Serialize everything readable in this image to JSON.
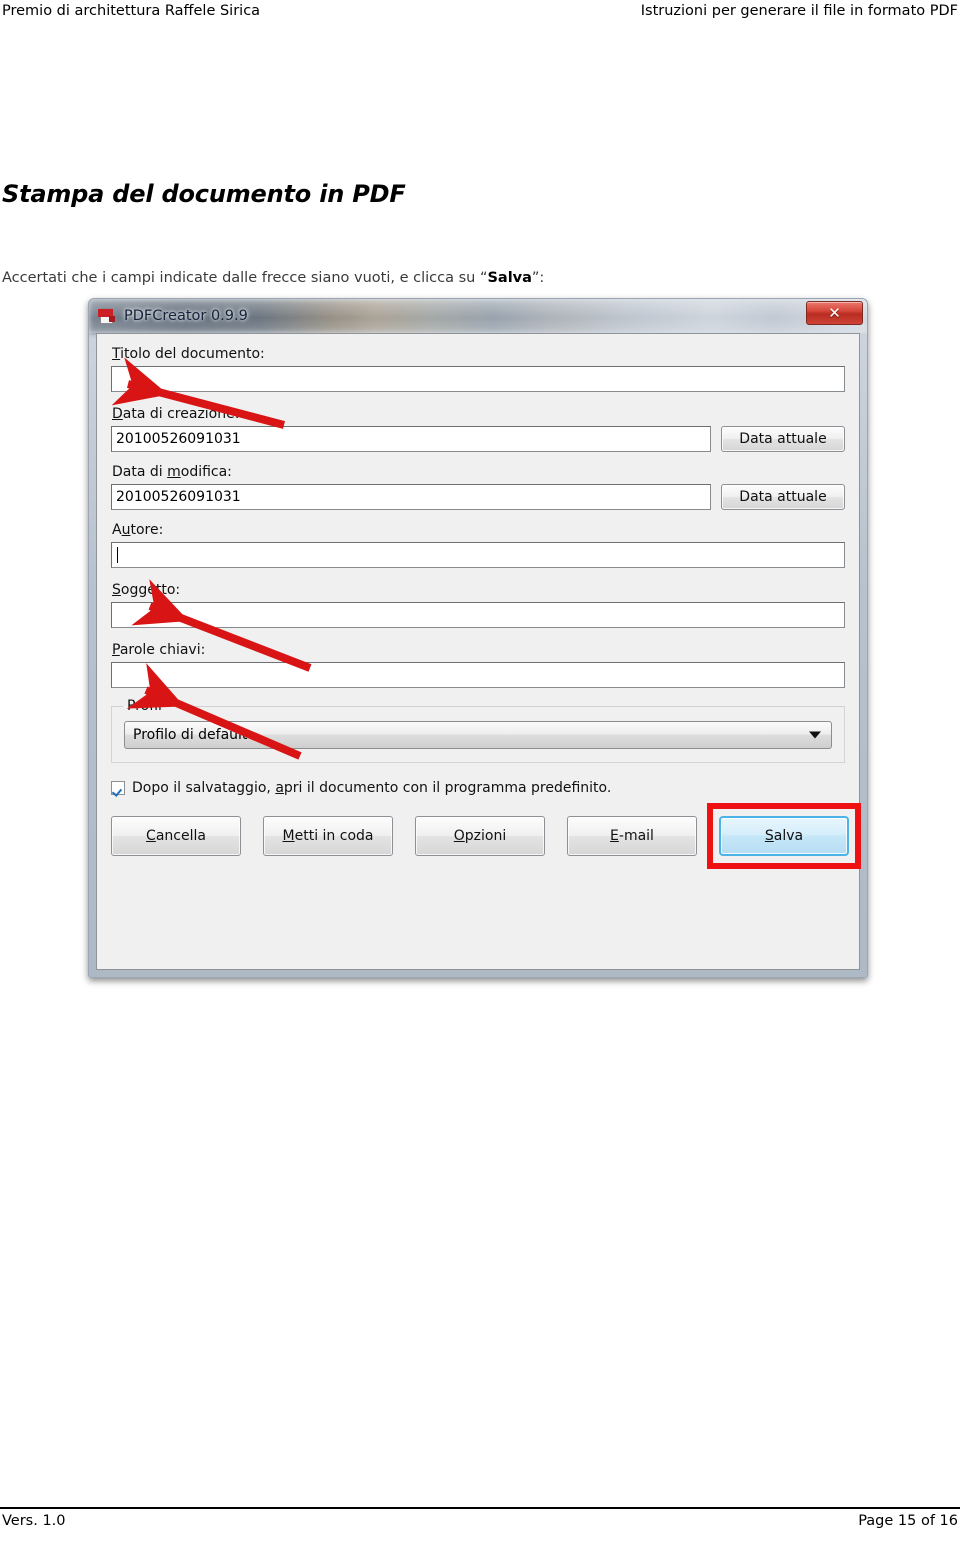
{
  "page_header": {
    "left": "Premio di architettura Raffele Sirica",
    "right": "Istruzioni per generare il file in formato PDF"
  },
  "document": {
    "section_title": "Stampa del documento in PDF",
    "intro_before": "Accertati che i campi indicate dalle frecce siano vuoti, e clicca su “",
    "intro_bold": "Salva",
    "intro_after": "”:"
  },
  "dialog": {
    "title": "PDFCreator 0.9.9",
    "window_icon": "pdf-document-icon",
    "close_label": "✕",
    "fields": [
      {
        "name": "titolo",
        "label_prefix": "",
        "label_accel": "T",
        "label_suffix": "itolo del documento:",
        "value": "",
        "has_caret": false,
        "side_button": null
      },
      {
        "name": "data-creazione",
        "label_prefix": "",
        "label_accel": "D",
        "label_suffix": "ata di creazione:",
        "value": "20100526091031",
        "has_caret": false,
        "side_button": "Data attuale"
      },
      {
        "name": "data-modifica",
        "label_prefix": "Data di ",
        "label_accel": "m",
        "label_suffix": "odifica:",
        "value": "20100526091031",
        "has_caret": false,
        "side_button": "Data attuale"
      },
      {
        "name": "autore",
        "label_prefix": "A",
        "label_accel": "u",
        "label_suffix": "tore:",
        "value": "",
        "has_caret": true,
        "side_button": null
      },
      {
        "name": "soggetto",
        "label_prefix": "",
        "label_accel": "S",
        "label_suffix": "oggetto:",
        "value": "",
        "has_caret": false,
        "side_button": null
      },
      {
        "name": "parole-chiavi",
        "label_prefix": "",
        "label_accel": "P",
        "label_suffix": "arole chiavi:",
        "value": "",
        "has_caret": false,
        "side_button": null
      }
    ],
    "profile_group": {
      "legend": "Profil",
      "selected_option": "Profilo di default",
      "options": [
        "Profilo di default"
      ]
    },
    "checkbox": {
      "checked": true,
      "label_prefix": "Dopo il salvataggio, ",
      "label_accel": "a",
      "label_suffix": "pri il documento con il programma predefinito."
    },
    "buttons": [
      {
        "name": "cancella",
        "prefix": "",
        "accel": "C",
        "suffix": "ancella",
        "primary": false
      },
      {
        "name": "metti-in-coda",
        "prefix": "",
        "accel": "M",
        "suffix": "etti in coda",
        "primary": false
      },
      {
        "name": "opzioni",
        "prefix": "",
        "accel": "O",
        "suffix": "pzioni",
        "primary": false
      },
      {
        "name": "email",
        "prefix": "",
        "accel": "E",
        "suffix": "-mail",
        "primary": false
      },
      {
        "name": "salva",
        "prefix": "",
        "accel": "S",
        "suffix": "alva",
        "primary": true
      }
    ],
    "annotation": {
      "arrow_color": "#d81414",
      "highlight_color": "#ee1111",
      "arrow_targets": [
        "titolo",
        "autore",
        "soggetto"
      ],
      "arrow_count": 3
    }
  },
  "page_footer": {
    "left": "Vers. 1.0",
    "right": "Page 15 of 16"
  },
  "colors": {
    "accent_red": "#cc2027",
    "focus_blue": "#4db3e6",
    "checkmark_blue": "#1d6fb8",
    "dialog_bg": "#f0f0f0"
  }
}
